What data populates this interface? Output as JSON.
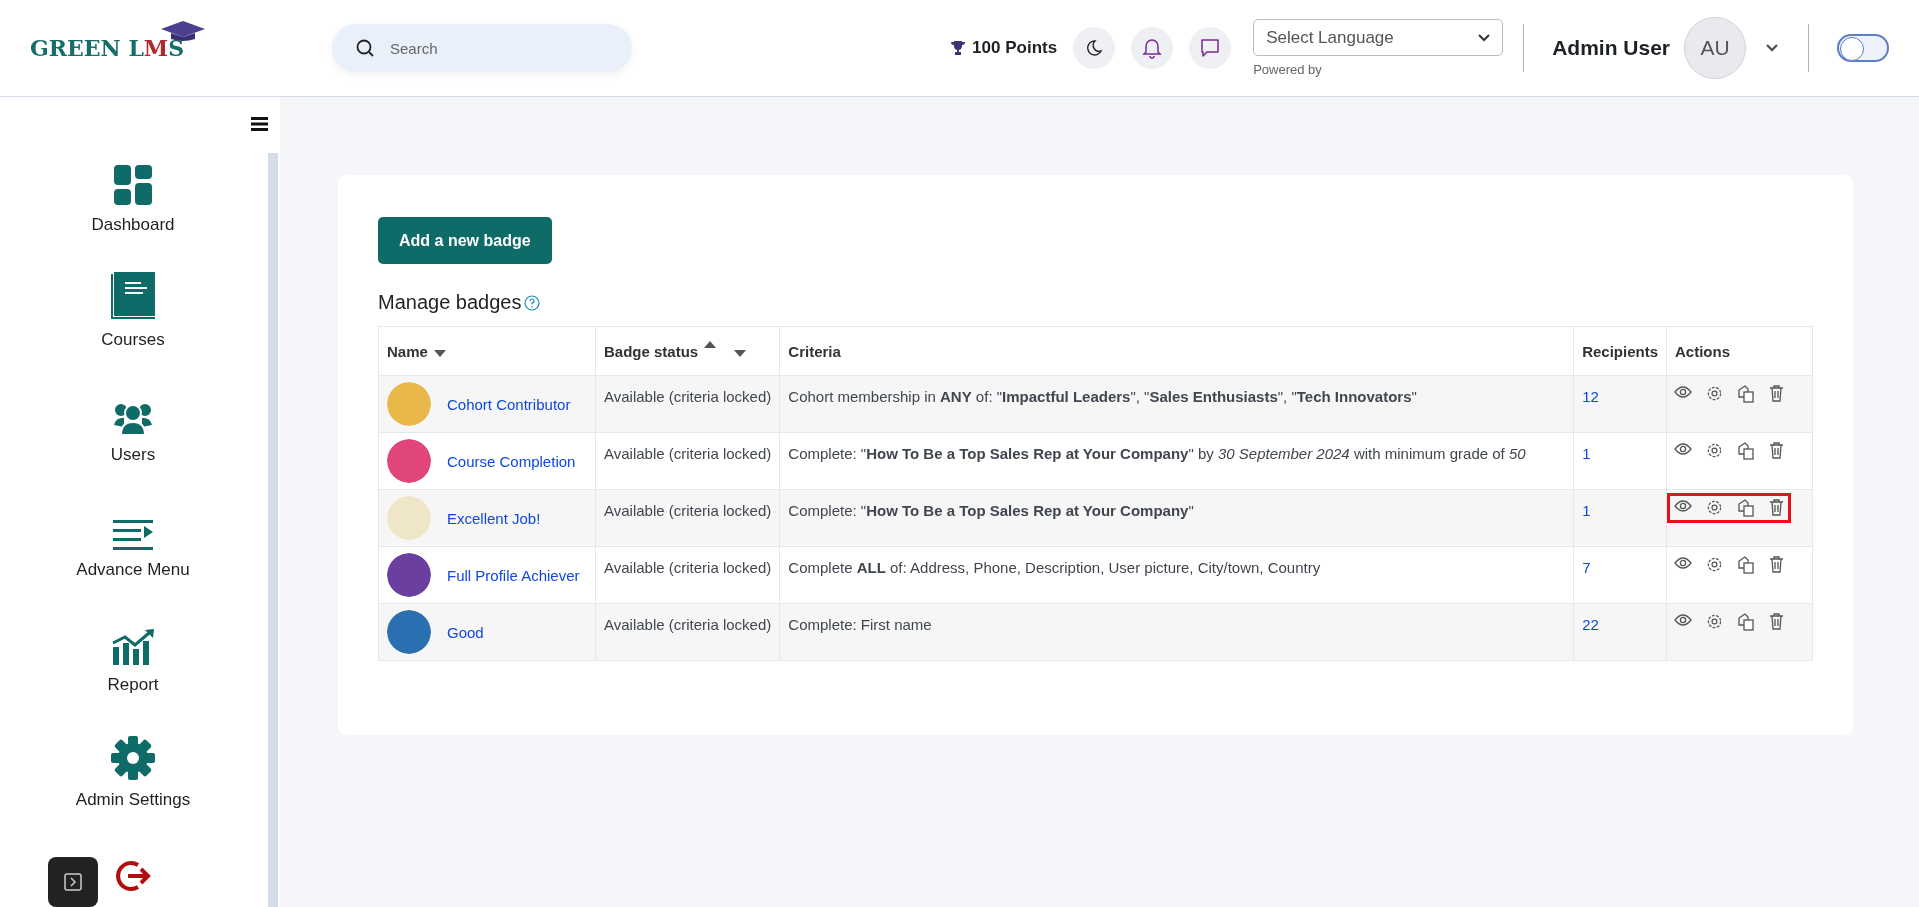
{
  "header": {
    "logo": {
      "text": "GREEN L",
      "accent": "M",
      "end": "S"
    },
    "search": {
      "placeholder": "Search"
    },
    "points": "100 Points",
    "language": {
      "value": "Select Language",
      "note": "Powered by"
    },
    "user": {
      "name": "Admin User",
      "initials": "AU"
    },
    "toggle": {
      "on": false
    }
  },
  "sidebar": {
    "items": [
      {
        "label": "Dashboard",
        "kind": "dashboard"
      },
      {
        "label": "Courses",
        "kind": "courses"
      },
      {
        "label": "Users",
        "kind": "users"
      },
      {
        "label": "Advance Menu",
        "kind": "menu"
      },
      {
        "label": "Report",
        "kind": "report"
      },
      {
        "label": "Admin Settings",
        "kind": "settings"
      },
      {
        "kind": "logout"
      }
    ]
  },
  "main": {
    "add_button": "Add a new badge",
    "title": "Manage badges",
    "table": {
      "columns": [
        {
          "label": "Name",
          "kind": "sortdesc"
        },
        {
          "label": "Badge status",
          "kind": "sortasc"
        },
        {
          "label": "Criteria",
          "kind": "plain"
        },
        {
          "label": "Recipients",
          "kind": "plain"
        },
        {
          "label": "Actions",
          "kind": "plain"
        }
      ],
      "rows": [
        {
          "name": "Cohort Contributor",
          "color": "#e8b94a",
          "status": "Available (criteria locked)",
          "criteria": "Cohort membership in **ANY** of: \"**Impactful Leaders**\", \"**Sales Enthusiasts**\", \"**Tech Innovators**\"",
          "recipients": "12",
          "highlighted": false
        },
        {
          "name": "Course Completion",
          "color": "#e0457b",
          "status": "Available (criteria locked)",
          "criteria": "Complete: \"**How To Be a Top Sales Rep at Your Company**\" by *30 September 2024* with minimum grade of *50*",
          "recipients": "1",
          "highlighted": false
        },
        {
          "name": "Excellent Job!",
          "color": "#efe6c8",
          "status": "Available (criteria locked)",
          "criteria": "Complete: \"**How To Be a Top Sales Rep at Your Company**\"",
          "recipients": "1",
          "highlighted": true
        },
        {
          "name": "Full Profile Achiever",
          "color": "#6b3fa0",
          "status": "Available (criteria locked)",
          "criteria": "Complete **ALL** of: Address, Phone, Description, User picture, City/town, Country",
          "recipients": "7",
          "highlighted": false
        },
        {
          "name": "Good",
          "color": "#2a6fb0",
          "status": "Available (criteria locked)",
          "criteria": "Complete: First name",
          "recipients": "22",
          "highlighted": false
        }
      ]
    }
  }
}
